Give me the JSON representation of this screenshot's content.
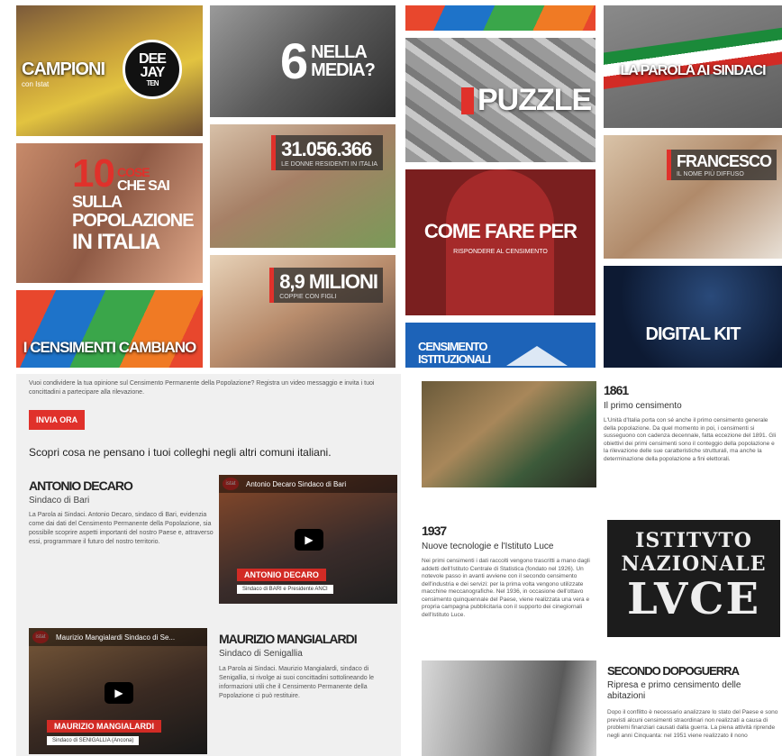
{
  "tiles": {
    "campioni": {
      "title": "CAMPIONI",
      "sub": "con Istat",
      "badge_top": "DEE",
      "badge_mid": "JAY",
      "badge_bot": "TEN"
    },
    "media": {
      "num": "6",
      "line1": "NELLA",
      "line2": "MEDIA?"
    },
    "cose": {
      "num": "10",
      "l1": "COSE",
      "l2": "CHE SAI",
      "l3": "SULLA",
      "l4": "POPOLAZIONE",
      "l5": "IN ITALIA"
    },
    "donne": {
      "num": "31.056.366",
      "sub": "LE DONNE RESIDENTI IN ITALIA"
    },
    "coppie": {
      "num": "8,9 MILIONI",
      "sub": "COPPIE CON FIGLI"
    },
    "censimenti": {
      "title": "I CENSIMENTI CAMBIANO"
    },
    "puzzle": {
      "title": "PUZZLE"
    },
    "comefare": {
      "title": "COME FARE PER",
      "sub": "RISPONDERE AL CENSIMENTO"
    },
    "istituzionali": {
      "title": "CENSIMENTO ISTITUZIONALI"
    },
    "sindaci": {
      "title": "LA PAROLA AI SINDACI"
    },
    "francesco": {
      "title": "FRANCESCO",
      "sub": "IL NOME PIÙ DIFFUSO"
    },
    "digital": {
      "title": "DIGITAL KIT"
    }
  },
  "sindaci_panel": {
    "intro": "Vuoi condividere la tua opinione sul Censimento Permanente della Popolazione? Registra un video messaggio e invita i tuoi concittadini a partecipare alla rilevazione.",
    "button": "INVIA ORA",
    "heading": "Scopri cosa ne pensano i tuoi colleghi negli altri comuni italiani.",
    "mayor1": {
      "name": "ANTONIO DECARO",
      "role": "Sindaco di Bari",
      "text": "La Parola ai Sindaci. Antonio Decaro, sindaco di Bari, evidenzia come dai dati del Censimento Permanente della Popolazione, sia possibile scoprire aspetti importanti del nostro Paese e, attraverso essi, programmare il futuro del nostro territorio.",
      "video_title": "Antonio Decaro Sindaco di Bari",
      "video_name": "ANTONIO DECARO",
      "video_role": "Sindaco di BARI e Presidente ANCI"
    },
    "mayor2": {
      "name": "MAURIZIO MANGIALARDI",
      "role": "Sindaco di Senigallia",
      "text": "La Parola ai Sindaci. Maurizio Mangialardi, sindaco di Senigallia, si rivolge ai suoi concittadini sottolineando le informazioni utili che il Censimento Permanente della Popolazione ci può restituire.",
      "video_title": "Maurizio Mangialardi Sindaco di Se...",
      "video_name": "MAURIZIO MANGIALARDI",
      "video_role": "Sindaco di SENIGALLIA (Ancona)"
    }
  },
  "history_panel": {
    "e1": {
      "year": "1861",
      "title": "Il primo censimento",
      "text": "L'Unità d'Italia porta con sé anche il primo censimento generale della popolazione. Da quel momento in poi, i censimenti si susseguono con cadenza decennale, fatta eccezione del 1891. Gli obiettivi dei primi censimenti sono il conteggio della popolazione e la rilevazione delle sue caratteristiche strutturali, ma anche la determinazione della popolazione a fini elettorali."
    },
    "e2": {
      "year": "1937",
      "title": "Nuove tecnologie e l'Istituto Luce",
      "text": "Nei primi censimenti i dati raccolti vengono trascritti a mano dagli addetti dell'Istituto Centrale di Statistica (fondato nel 1926). Un notevole passo in avanti avviene con il secondo censimento dell'industria e dei servizi: per la prima volta vengono utilizzate macchine meccanografiche. Nel 1936, in occasione dell'ottavo censimento quinquennale del Paese, viene realizzata una vera e propria campagna pubblicitaria con il supporto dei cinegiornali dell'Istituto Luce."
    },
    "e3": {
      "year": "SECONDO DOPOGUERRA",
      "title": "Ripresa e primo censimento delle abitazioni",
      "text": "Dopo il conflitto è necessario analizzare lo stato del Paese e sono previsti alcuni censimenti straordinari non realizzati a causa di problemi finanziari causati dalla guerra. La piena attività riprende negli anni Cinquanta: nel 1951 viene realizzato il nono"
    },
    "luce": {
      "l1": "ISTITVTO",
      "l2": "NAZIONALE",
      "l3": "LVCE"
    }
  },
  "colors": {
    "red": "#e0312b",
    "panel": "#f0f0f0"
  }
}
